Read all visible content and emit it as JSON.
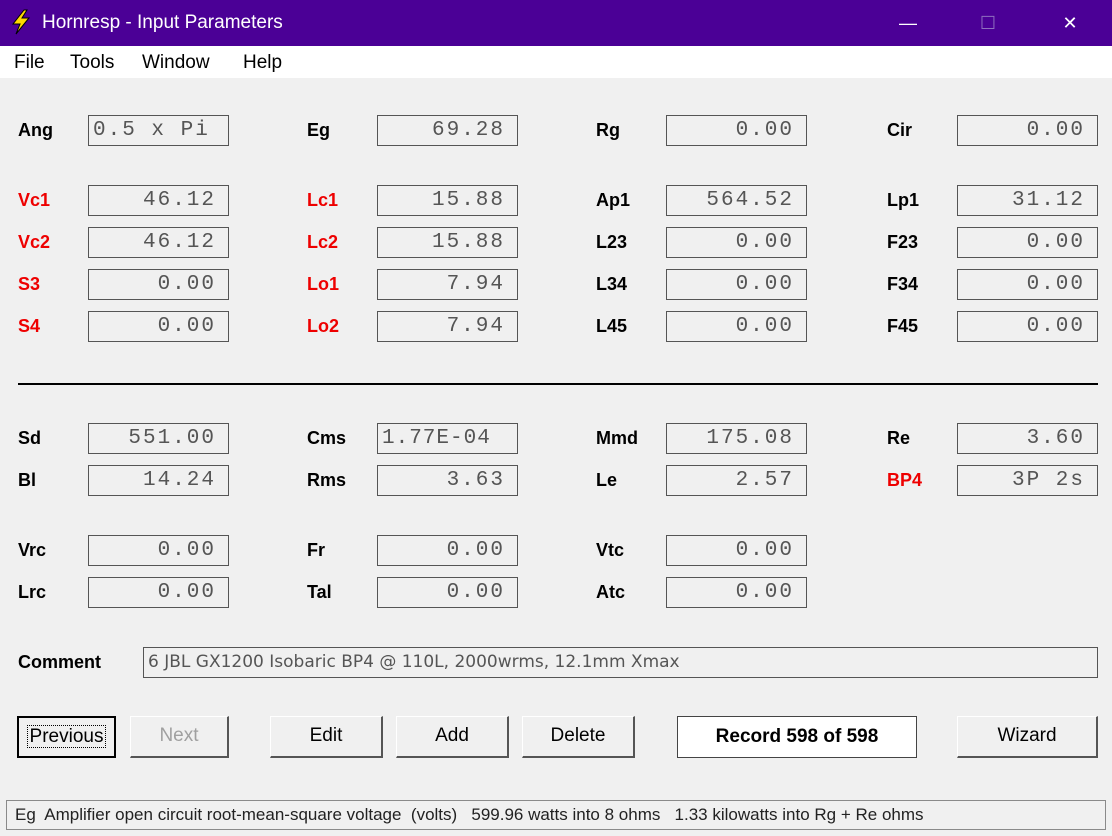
{
  "window": {
    "title": "Hornresp - Input Parameters",
    "icon": "lightning-bolt-icon",
    "controls": {
      "minimize": "—",
      "maximize": "☐",
      "close": "✕"
    }
  },
  "menu": {
    "file": "File",
    "tools": "Tools",
    "window": "Window",
    "help": "Help"
  },
  "params": {
    "ang": {
      "label": "Ang",
      "value": "0.5 x Pi"
    },
    "eg": {
      "label": "Eg",
      "value": "69.28"
    },
    "rg": {
      "label": "Rg",
      "value": "0.00"
    },
    "cir": {
      "label": "Cir",
      "value": "0.00"
    },
    "vc1": {
      "label": "Vc1",
      "value": "46.12"
    },
    "lc1": {
      "label": "Lc1",
      "value": "15.88"
    },
    "ap1": {
      "label": "Ap1",
      "value": "564.52"
    },
    "lp1": {
      "label": "Lp1",
      "value": "31.12"
    },
    "vc2": {
      "label": "Vc2",
      "value": "46.12"
    },
    "lc2": {
      "label": "Lc2",
      "value": "15.88"
    },
    "l23": {
      "label": "L23",
      "value": "0.00"
    },
    "f23": {
      "label": "F23",
      "value": "0.00"
    },
    "s3": {
      "label": "S3",
      "value": "0.00"
    },
    "lo1": {
      "label": "Lo1",
      "value": "7.94"
    },
    "l34": {
      "label": "L34",
      "value": "0.00"
    },
    "f34": {
      "label": "F34",
      "value": "0.00"
    },
    "s4": {
      "label": "S4",
      "value": "0.00"
    },
    "lo2": {
      "label": "Lo2",
      "value": "7.94"
    },
    "l45": {
      "label": "L45",
      "value": "0.00"
    },
    "f45": {
      "label": "F45",
      "value": "0.00"
    },
    "sd": {
      "label": "Sd",
      "value": "551.00"
    },
    "cms": {
      "label": "Cms",
      "value": "1.77E-04"
    },
    "mmd": {
      "label": "Mmd",
      "value": "175.08"
    },
    "re": {
      "label": "Re",
      "value": "3.60"
    },
    "bl": {
      "label": "Bl",
      "value": "14.24"
    },
    "rms": {
      "label": "Rms",
      "value": "3.63"
    },
    "le": {
      "label": "Le",
      "value": "2.57"
    },
    "bp4": {
      "label": "BP4",
      "value": "3P 2s"
    },
    "vrc": {
      "label": "Vrc",
      "value": "0.00"
    },
    "fr": {
      "label": "Fr",
      "value": "0.00"
    },
    "vtc": {
      "label": "Vtc",
      "value": "0.00"
    },
    "lrc": {
      "label": "Lrc",
      "value": "0.00"
    },
    "tal": {
      "label": "Tal",
      "value": "0.00"
    },
    "atc": {
      "label": "Atc",
      "value": "0.00"
    }
  },
  "colors": {
    "title_bar": "#4b0096",
    "highlight_label": "#ee0000"
  },
  "comment": {
    "label": "Comment",
    "value": "6 JBL GX1200 Isobaric BP4 @ 110L, 2000wrms, 12.1mm Xmax"
  },
  "buttons": {
    "previous": "Previous",
    "next": "Next",
    "edit": "Edit",
    "add": "Add",
    "delete": "Delete",
    "wizard": "Wizard"
  },
  "record": "Record 598 of 598",
  "status": "Eg  Amplifier open circuit root-mean-square voltage  (volts)   599.96 watts into 8 ohms   1.33 kilowatts into Rg + Re ohms"
}
